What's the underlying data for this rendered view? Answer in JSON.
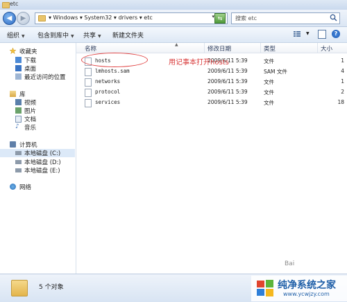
{
  "window": {
    "title": "etc"
  },
  "address": {
    "path": "▾ Windows ▾ System32 ▾ drivers ▾ etc",
    "search_placeholder": "搜索 etc"
  },
  "toolbar": {
    "organize": "组织",
    "include_library": "包含到库中",
    "share": "共享",
    "new_folder": "新建文件夹"
  },
  "nav": {
    "favorites": "收藏夹",
    "downloads": "下载",
    "desktop": "桌面",
    "recent": "最近访问的位置",
    "libraries": "库",
    "videos": "视频",
    "pictures": "图片",
    "documents": "文档",
    "music": "音乐",
    "computer": "计算机",
    "drive_c": "本地磁盘 (C:)",
    "drive_d": "本地磁盘 (D:)",
    "drive_e": "本地磁盘 (E:)",
    "network": "网络"
  },
  "columns": {
    "name": "名称",
    "modified": "修改日期",
    "type": "类型",
    "size": "大小"
  },
  "files": [
    {
      "name": "hosts",
      "modified": "2009/6/11 5:39",
      "type": "文件",
      "size": "1"
    },
    {
      "name": "lmhosts.sam",
      "modified": "2009/6/11 5:39",
      "type": "SAM 文件",
      "size": "4"
    },
    {
      "name": "networks",
      "modified": "2009/6/11 5:39",
      "type": "文件",
      "size": "1"
    },
    {
      "name": "protocol",
      "modified": "2009/6/11 5:39",
      "type": "文件",
      "size": "2"
    },
    {
      "name": "services",
      "modified": "2009/6/11 5:39",
      "type": "文件",
      "size": "18"
    }
  ],
  "annotation": "用记事本打开hosts",
  "status": {
    "count": "5 个对象"
  },
  "watermark": {
    "title": "纯净系统之家",
    "url": "www.ycwjzy.com"
  },
  "stamp": "Bai"
}
